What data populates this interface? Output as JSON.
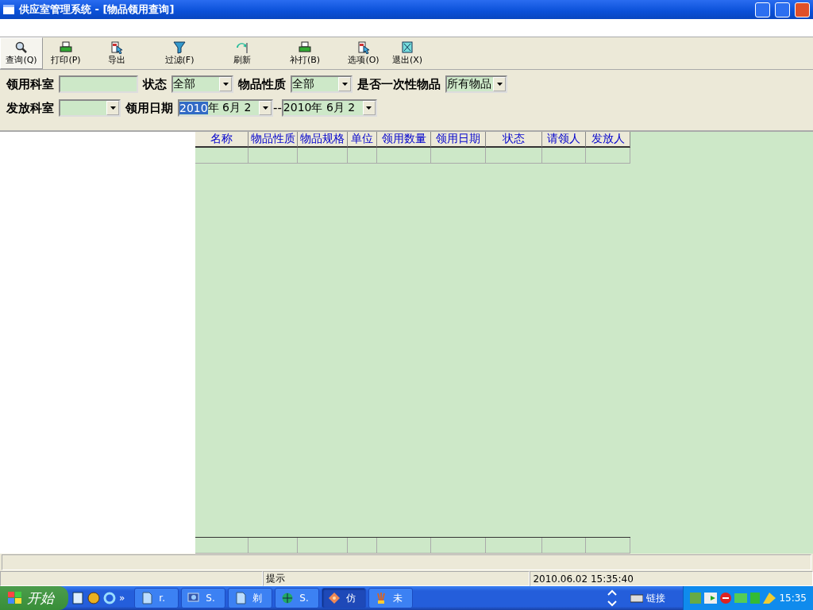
{
  "window": {
    "title": "供应室管理系统 - [物品领用查询]"
  },
  "toolbar": [
    {
      "label": "查询(Q)",
      "selected": true
    },
    {
      "label": "打印(P)",
      "selected": false
    },
    {
      "label": "导出",
      "selected": false
    },
    {
      "label": "过滤(F)",
      "selected": false
    },
    {
      "label": "刷新",
      "selected": false
    },
    {
      "label": "补打(B)",
      "selected": false
    },
    {
      "label": "选项(O)",
      "selected": false
    },
    {
      "label": "退出(X)",
      "selected": false
    }
  ],
  "filters": [
    [
      {
        "kind": "text",
        "label": "领用科室"
      },
      {
        "kind": "combo",
        "label": "状态",
        "value": "全部"
      },
      {
        "kind": "combo",
        "label": "物品性质",
        "value": "全部"
      },
      {
        "kind": "combo",
        "label": "是否一次性物品",
        "value": "所有物品"
      }
    ],
    [
      {
        "kind": "combo",
        "label": "发放科室"
      },
      {
        "kind": "daterange",
        "label": "领用日期",
        "from_selected": "2010",
        "from_rest": "年 6月 2",
        "separator": "--",
        "to": "2010年 6月 2"
      }
    ]
  ],
  "table": {
    "columns": [
      "名称",
      "物品性质",
      "物品规格",
      "单位",
      "领用数量",
      "领用日期",
      "状态",
      "请领人",
      "发放人"
    ]
  },
  "status_bar": [
    "提示",
    "2010.06.02 15:35:40"
  ],
  "taskbar": {
    "start": "开始",
    "quick_launch_more": "»",
    "tasks": [
      {
        "label": "r.",
        "selected": false
      },
      {
        "label": "S.",
        "selected": false
      },
      {
        "label": "剃",
        "selected": false
      },
      {
        "label": "S.",
        "selected": false
      },
      {
        "label": "仿",
        "selected": true
      },
      {
        "label": "未",
        "selected": false
      }
    ],
    "links": "链接",
    "clock": "15:35"
  }
}
